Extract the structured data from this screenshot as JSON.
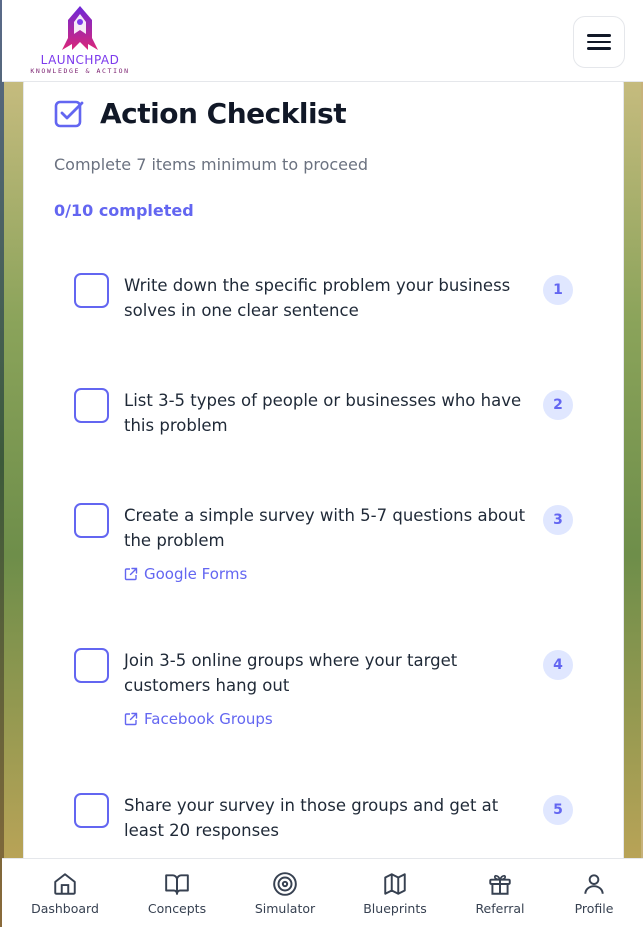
{
  "header": {
    "logo_title": "LAUNCHPAD",
    "logo_subtitle": "KNOWLEDGE & ACTION",
    "menu_icon": "hamburger-icon"
  },
  "checklist": {
    "title": "Action Checklist",
    "subtitle": "Complete 7 items minimum to proceed",
    "progress": "0/10 completed",
    "items": [
      {
        "number": "1",
        "text": "Write down the specific problem your business solves in one clear sentence",
        "checked": false
      },
      {
        "number": "2",
        "text": "List 3-5 types of people or businesses who have this problem",
        "checked": false
      },
      {
        "number": "3",
        "text": "Create a simple survey with 5-7 questions about the problem",
        "link": "Google Forms",
        "checked": false
      },
      {
        "number": "4",
        "text": "Join 3-5 online groups where your target customers hang out",
        "link": "Facebook Groups",
        "checked": false
      },
      {
        "number": "5",
        "text": "Share your survey in those groups and get at least 20 responses",
        "checked": false
      }
    ]
  },
  "nav": {
    "items": [
      {
        "label": "Dashboard",
        "icon": "home-icon"
      },
      {
        "label": "Concepts",
        "icon": "book-icon"
      },
      {
        "label": "Simulator",
        "icon": "target-icon"
      },
      {
        "label": "Blueprints",
        "icon": "map-icon"
      },
      {
        "label": "Referral",
        "icon": "gift-icon"
      },
      {
        "label": "Profile",
        "icon": "user-icon"
      }
    ]
  },
  "colors": {
    "accent": "#6366f1",
    "badge_bg": "#e0e7ff",
    "logo_purple": "#7c3aed"
  }
}
